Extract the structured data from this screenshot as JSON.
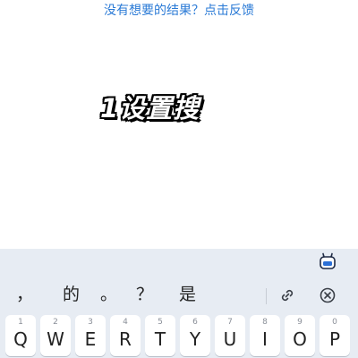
{
  "feedback_link": "没有想要的结果？点击反馈",
  "overlay_text": "1设置搜",
  "colors": {
    "link": "#2a7ad6",
    "keyboard_bg": "#e7ecf3",
    "key_bg": "#ffffff"
  },
  "candidates": [
    "，",
    "的",
    "。",
    "？",
    "是"
  ],
  "toolbar_icons": [
    "link-icon",
    "close-circle-icon"
  ],
  "keyboard_logo": "keyboard-mascot-icon",
  "keys": [
    {
      "char": "Q",
      "hint": "1"
    },
    {
      "char": "W",
      "hint": "2"
    },
    {
      "char": "E",
      "hint": "3"
    },
    {
      "char": "R",
      "hint": "4"
    },
    {
      "char": "T",
      "hint": "5"
    },
    {
      "char": "Y",
      "hint": "6"
    },
    {
      "char": "U",
      "hint": "7"
    },
    {
      "char": "I",
      "hint": "8"
    },
    {
      "char": "O",
      "hint": "9"
    },
    {
      "char": "P",
      "hint": "0"
    }
  ]
}
